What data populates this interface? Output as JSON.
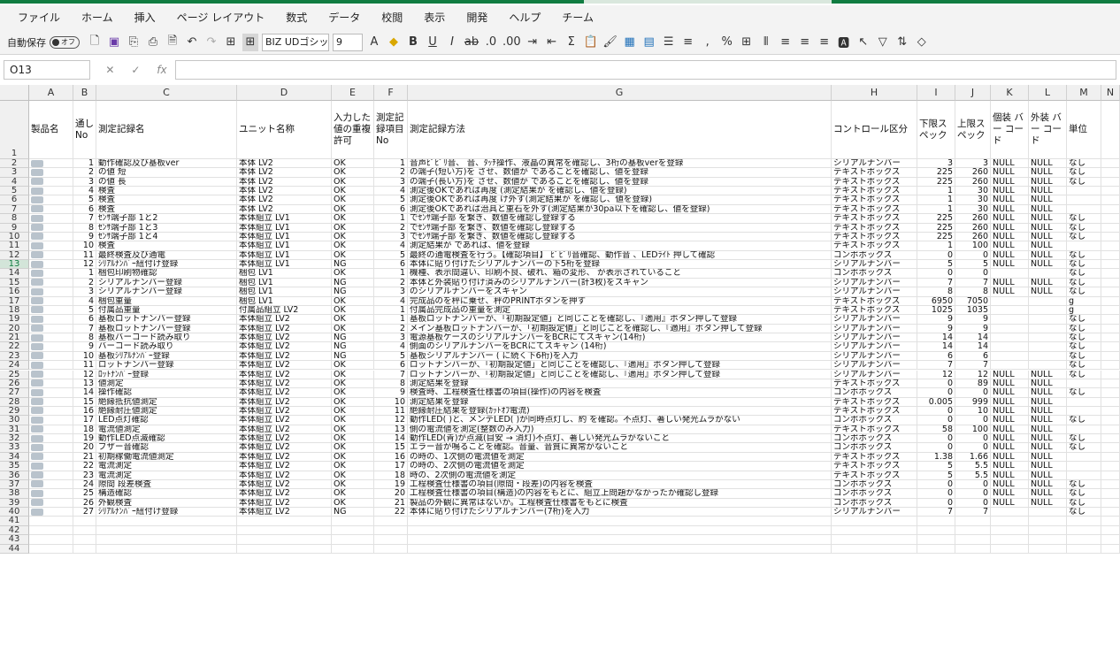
{
  "ribbon_tabs": [
    "ファイル",
    "ホーム",
    "挿入",
    "ページ レイアウト",
    "数式",
    "データ",
    "校閲",
    "表示",
    "開発",
    "ヘルプ",
    "チーム"
  ],
  "toolbar": {
    "autosave_label": "自動保存",
    "autosave_state": "オフ",
    "font_name": "BIZ UDゴシッ",
    "font_size": "9"
  },
  "formula_bar": {
    "name_box": "O13",
    "fx": "fx",
    "cancel": "✕",
    "confirm": "✓",
    "formula": ""
  },
  "columns": [
    "A",
    "B",
    "C",
    "D",
    "E",
    "F",
    "G",
    "H",
    "I",
    "J",
    "K",
    "L",
    "M",
    "N"
  ],
  "header_row": {
    "a": "製品名",
    "b": "通し No",
    "c": "測定記録名",
    "d": "ユニット名称",
    "e": "入力した 値の重複 許可",
    "f": "測定記 録項目 No",
    "g": "測定記録方法",
    "h": "コントロール区分",
    "i": "下限ス ペック",
    "j": "上限ス ペック",
    "k": "個装 バー コード",
    "l": "外装 バー コード",
    "m": "単位"
  },
  "rows": [
    {
      "r": "2",
      "b": "1",
      "c": "動作確認及び基板ver",
      "d": "本体 LV2",
      "e": "OK",
      "f": "1",
      "g": "音声ﾋﾟﾋﾟﾘ音、 音、ﾀｯﾁ操作、液晶の異常を確認し、3桁の基板verを登録",
      "h": "シリアルナンバー",
      "i": "3",
      "j": "3",
      "k": "NULL",
      "l": "NULL",
      "m": "なし"
    },
    {
      "r": "3",
      "b": "2",
      "c": "の値 短",
      "d": "本体 LV2",
      "e": "OK",
      "f": "2",
      "g": "の端子(短い方)を させ、数値が であることを確認し、値を登録",
      "h": "テキストボックス",
      "i": "225",
      "j": "260",
      "k": "NULL",
      "l": "NULL",
      "m": "なし"
    },
    {
      "r": "4",
      "b": "3",
      "c": "の値 長",
      "d": "本体 LV2",
      "e": "OK",
      "f": "3",
      "g": "の端子(長い方)を させ、数値が であることを確認し、値を登録",
      "h": "テキストボックス",
      "i": "225",
      "j": "260",
      "k": "NULL",
      "l": "NULL",
      "m": "なし"
    },
    {
      "r": "5",
      "b": "4",
      "c": "検査",
      "d": "本体 LV2",
      "e": "OK",
      "f": "4",
      "g": "測定後OKであれば再度 (測定結果が を確認し、値を登録)",
      "h": "テキストボックス",
      "i": "1",
      "j": "30",
      "k": "NULL",
      "l": "NULL",
      "m": ""
    },
    {
      "r": "6",
      "b": "5",
      "c": "検査",
      "d": "本体 LV2",
      "e": "OK",
      "f": "5",
      "g": "測定後OKであれば再度 け外す(測定結果が を確認し、値を登録)",
      "h": "テキストボックス",
      "i": "1",
      "j": "30",
      "k": "NULL",
      "l": "NULL",
      "m": ""
    },
    {
      "r": "7",
      "b": "6",
      "c": "検査",
      "d": "本体 LV2",
      "e": "OK",
      "f": "6",
      "g": "測定後OKであれば治具と重石を外す(測定結果が30pa以下を確認し、値を登録)",
      "h": "テキストボックス",
      "i": "1",
      "j": "30",
      "k": "NULL",
      "l": "NULL",
      "m": ""
    },
    {
      "r": "8",
      "b": "7",
      "c": "ｾﾝｻ端子部 1と2",
      "d": "本体組立 LV1",
      "e": "OK",
      "f": "1",
      "g": "でｾﾝｻ端子部 を繋ぎ、数値を確認し登録する",
      "h": "テキストボックス",
      "i": "225",
      "j": "260",
      "k": "NULL",
      "l": "NULL",
      "m": "なし"
    },
    {
      "r": "9",
      "b": "8",
      "c": "ｾﾝｻ端子部 1と3",
      "d": "本体組立 LV1",
      "e": "OK",
      "f": "2",
      "g": "でｾﾝｻ端子部 を繋ぎ、数値を確認し登録する",
      "h": "テキストボックス",
      "i": "225",
      "j": "260",
      "k": "NULL",
      "l": "NULL",
      "m": "なし"
    },
    {
      "r": "10",
      "b": "9",
      "c": "ｾﾝｻ端子部 1と4",
      "d": "本体組立 LV1",
      "e": "OK",
      "f": "3",
      "g": "でｾﾝｻ端子部 を繋ぎ、数値を確認し登録する",
      "h": "テキストボックス",
      "i": "225",
      "j": "260",
      "k": "NULL",
      "l": "NULL",
      "m": "なし"
    },
    {
      "r": "11",
      "b": "10",
      "c": "検査",
      "d": "本体組立 LV1",
      "e": "OK",
      "f": "4",
      "g": "測定結果が であれば、値を登録",
      "h": "テキストボックス",
      "i": "1",
      "j": "100",
      "k": "NULL",
      "l": "NULL",
      "m": ""
    },
    {
      "r": "12",
      "b": "11",
      "c": "最終検査及び通電",
      "d": "本体組立 LV1",
      "e": "OK",
      "f": "5",
      "g": "最終の通電検査を行う。【確認項目】 ﾋﾟﾋﾟﾘ音確認、動作音 、LEDﾗｲﾄ 押して確認",
      "h": "コンボボックス",
      "i": "0",
      "j": "0",
      "k": "NULL",
      "l": "NULL",
      "m": "なし"
    },
    {
      "r": "13",
      "b": "12",
      "c": "ｼﾘｱﾙﾅﾝﾊﾞｰ紐付け登録",
      "d": "本体組立 LV1",
      "e": "NG",
      "f": "6",
      "g": "本体に貼り付けたシリアルナンバーの下5桁を登録",
      "h": "シリアルナンバー",
      "i": "5",
      "j": "5",
      "k": "NULL",
      "l": "NULL",
      "m": "なし"
    },
    {
      "r": "14",
      "b": "1",
      "c": "梱包印刷物確認",
      "d": "梱包 LV1",
      "e": "OK",
      "f": "1",
      "g": "機種、表示間違い、印刷不良、破れ、箱の変形、 が表示されていること",
      "h": "コンボボックス",
      "i": "0",
      "j": "0",
      "k": "",
      "l": "",
      "m": "なし"
    },
    {
      "r": "15",
      "b": "2",
      "c": "シリアルナンバー登録",
      "d": "梱包 LV1",
      "e": "NG",
      "f": "2",
      "g": "本体と外装貼り付け済みのシリアルナンバー(計3枚)をスキャン",
      "h": "シリアルナンバー",
      "i": "7",
      "j": "7",
      "k": "NULL",
      "l": "NULL",
      "m": "なし"
    },
    {
      "r": "16",
      "b": "3",
      "c": "シリアルナンバー登録",
      "d": "梱包 LV1",
      "e": "NG",
      "f": "3",
      "g": "のシリアルナンバーをスキャン",
      "h": "シリアルナンバー",
      "i": "8",
      "j": "8",
      "k": "NULL",
      "l": "NULL",
      "m": "なし"
    },
    {
      "r": "17",
      "b": "4",
      "c": "梱包重量",
      "d": "梱包 LV1",
      "e": "OK",
      "f": "4",
      "g": "完成品のを秤に乗せ、秤のPRINTボタンを押す",
      "h": "テキストボックス",
      "i": "6950",
      "j": "7050",
      "k": "",
      "l": "",
      "m": "g"
    },
    {
      "r": "18",
      "b": "5",
      "c": "付属品重量",
      "d": "付属品組立 LV2",
      "e": "OK",
      "f": "1",
      "g": "付属品完成品の重量を測定",
      "h": "テキストボックス",
      "i": "1025",
      "j": "1035",
      "k": "",
      "l": "",
      "m": "g"
    },
    {
      "r": "19",
      "b": "6",
      "c": "基板ロットナンバー登録",
      "d": "本体組立 LV2",
      "e": "OK",
      "f": "1",
      "g": "基板ロットナンバーが、「初期設定値」と同じことを確認し、『適用』ボタン押して登録",
      "h": "シリアルナンバー",
      "i": "9",
      "j": "9",
      "k": "",
      "l": "",
      "m": "なし"
    },
    {
      "r": "20",
      "b": "7",
      "c": "基板ロットナンバー登録",
      "d": "本体組立 LV2",
      "e": "OK",
      "f": "2",
      "g": "メイン基板ロットナンバーが、「初期設定値」と同じことを確認し、『適用』ボタン押して登録",
      "h": "シリアルナンバー",
      "i": "9",
      "j": "9",
      "k": "",
      "l": "",
      "m": "なし"
    },
    {
      "r": "21",
      "b": "8",
      "c": "基板バーコード読み取り",
      "d": "本体組立 LV2",
      "e": "NG",
      "f": "3",
      "g": "電源基板ケースのシリアルナンバーをBCRにてスキャン(14桁)",
      "h": "シリアルナンバー",
      "i": "14",
      "j": "14",
      "k": "",
      "l": "",
      "m": "なし"
    },
    {
      "r": "22",
      "b": "9",
      "c": "バーコード読み取り",
      "d": "本体組立 LV2",
      "e": "NG",
      "f": "4",
      "g": "側面のシリアルナンバーをBCRにてスキャン (14桁)",
      "h": "シリアルナンバー",
      "i": "14",
      "j": "14",
      "k": "",
      "l": "",
      "m": "なし"
    },
    {
      "r": "23",
      "b": "10",
      "c": "基板ｼﾘｱﾙﾅﾝﾊﾞｰ登録",
      "d": "本体組立 LV2",
      "e": "NG",
      "f": "5",
      "g": "基板シリアルナンバー ( に続く下6桁)を入力",
      "h": "シリアルナンバー",
      "i": "6",
      "j": "6",
      "k": "",
      "l": "",
      "m": "なし"
    },
    {
      "r": "24",
      "b": "11",
      "c": "ロットナンバー登録",
      "d": "本体組立 LV2",
      "e": "OK",
      "f": "6",
      "g": "ロットナンバーが、「初期設定値」と同じことを確認し、『適用』ボタン押して登録",
      "h": "シリアルナンバー",
      "i": "7",
      "j": "7",
      "k": "",
      "l": "",
      "m": "なし"
    },
    {
      "r": "25",
      "b": "12",
      "c": "ﾛｯﾄﾅﾝﾊﾞｰ登録",
      "d": "本体組立 LV2",
      "e": "OK",
      "f": "7",
      "g": "ロットナンバーが、「初期設定値」と同じことを確認し、『適用』ボタン押して登録",
      "h": "シリアルナンバー",
      "i": "12",
      "j": "12",
      "k": "NULL",
      "l": "NULL",
      "m": "なし"
    },
    {
      "r": "26",
      "b": "13",
      "c": "値測定",
      "d": "本体組立 LV2",
      "e": "OK",
      "f": "8",
      "g": "測定結果を登録",
      "h": "テキストボックス",
      "i": "0",
      "j": "89",
      "k": "NULL",
      "l": "NULL",
      "m": ""
    },
    {
      "r": "27",
      "b": "14",
      "c": "操作確認",
      "d": "本体組立 LV2",
      "e": "OK",
      "f": "9",
      "g": "検査時、工程検査仕様書の項目(操作)の内容を検査",
      "h": "コンボボックス",
      "i": "0",
      "j": "0",
      "k": "NULL",
      "l": "NULL",
      "m": "なし"
    },
    {
      "r": "28",
      "b": "15",
      "c": "絶縁抵抗値測定",
      "d": "本体組立 LV2",
      "e": "OK",
      "f": "10",
      "g": "測定結果を登録",
      "h": "テキストボックス",
      "i": "0.005",
      "j": "999",
      "k": "NULL",
      "l": "NULL",
      "m": ""
    },
    {
      "r": "29",
      "b": "16",
      "c": "絶縁耐圧値測定",
      "d": "本体組立 LV2",
      "e": "OK",
      "f": "11",
      "g": "絶縁耐圧結果を登録(ｶｯﾄｵﾌ電流)",
      "h": "テキストボックス",
      "i": "0",
      "j": "10",
      "k": "NULL",
      "l": "NULL",
      "m": ""
    },
    {
      "r": "30",
      "b": "17",
      "c": "LED点灯確認",
      "d": "本体組立 LV2",
      "e": "OK",
      "f": "12",
      "g": "動作LED( )と、メンテLED( )が同時点灯し、約 を確認。不点灯、著しい発光ムラがない",
      "h": "コンボボックス",
      "i": "0",
      "j": "0",
      "k": "NULL",
      "l": "NULL",
      "m": "なし"
    },
    {
      "r": "31",
      "b": "18",
      "c": "電流値測定",
      "d": "本体組立 LV2",
      "e": "OK",
      "f": "13",
      "g": "側の電流値を測定(整数のみ入力)",
      "h": "テキストボックス",
      "i": "58",
      "j": "100",
      "k": "NULL",
      "l": "NULL",
      "m": ""
    },
    {
      "r": "32",
      "b": "19",
      "c": "動作LED点滅確認",
      "d": "本体組立 LV2",
      "e": "OK",
      "f": "14",
      "g": "動作LED(青)が点滅(目安 → 消灯)不点灯、著しい発光ムラがないこと",
      "h": "コンボボックス",
      "i": "0",
      "j": "0",
      "k": "NULL",
      "l": "NULL",
      "m": "なし"
    },
    {
      "r": "33",
      "b": "20",
      "c": "ブザー音確認",
      "d": "本体組立 LV2",
      "e": "OK",
      "f": "15",
      "g": "エラー音が鳴ることを確認。音量、音質に異常がないこと",
      "h": "コンボボックス",
      "i": "0",
      "j": "0",
      "k": "NULL",
      "l": "NULL",
      "m": "なし"
    },
    {
      "r": "34",
      "b": "21",
      "c": "初期稼働電流値測定",
      "d": "本体組立 LV2",
      "e": "OK",
      "f": "16",
      "g": "の時の、1次側の電流値を測定",
      "h": "テキストボックス",
      "i": "1.38",
      "j": "1.66",
      "k": "NULL",
      "l": "NULL",
      "m": ""
    },
    {
      "r": "35",
      "b": "22",
      "c": "電流測定",
      "d": "本体組立 LV2",
      "e": "OK",
      "f": "17",
      "g": "の時の、2次側の電流値を測定",
      "h": "テキストボックス",
      "i": "5",
      "j": "5.5",
      "k": "NULL",
      "l": "NULL",
      "m": ""
    },
    {
      "r": "36",
      "b": "23",
      "c": "電流測定",
      "d": "本体組立 LV2",
      "e": "OK",
      "f": "18",
      "g": "時の、2次側の電流値を測定",
      "h": "テキストボックス",
      "i": "5",
      "j": "5.5",
      "k": "NULL",
      "l": "NULL",
      "m": ""
    },
    {
      "r": "37",
      "b": "24",
      "c": "隙間 段差検査",
      "d": "本体組立 LV2",
      "e": "OK",
      "f": "19",
      "g": "工程検査仕様書の項目(隙間・段差)の内容を検査",
      "h": "コンボボックス",
      "i": "0",
      "j": "0",
      "k": "NULL",
      "l": "NULL",
      "m": "なし"
    },
    {
      "r": "38",
      "b": "25",
      "c": "構造確認",
      "d": "本体組立 LV2",
      "e": "OK",
      "f": "20",
      "g": "工程検査仕様書の項目(構造)の内容をもとに、組立上問題がなかったか確認し登録",
      "h": "コンボボックス",
      "i": "0",
      "j": "0",
      "k": "NULL",
      "l": "NULL",
      "m": "なし"
    },
    {
      "r": "39",
      "b": "26",
      "c": "外観検査",
      "d": "本体組立 LV2",
      "e": "OK",
      "f": "21",
      "g": "製品の外観に異常はないか。工程検査仕様書をもとに検査",
      "h": "コンボボックス",
      "i": "0",
      "j": "0",
      "k": "NULL",
      "l": "NULL",
      "m": "なし"
    },
    {
      "r": "40",
      "b": "27",
      "c": "ｼﾘｱﾙﾅﾝﾊﾞｰ紐付け登録",
      "d": "本体組立 LV2",
      "e": "NG",
      "f": "22",
      "g": "本体に貼り付けたシリアルナンバー(7桁)を入力",
      "h": "シリアルナンバー",
      "i": "7",
      "j": "7",
      "k": "",
      "l": "",
      "m": "なし"
    }
  ],
  "empty_rows": [
    "41",
    "42",
    "43",
    "44"
  ],
  "first_row_label": "1"
}
